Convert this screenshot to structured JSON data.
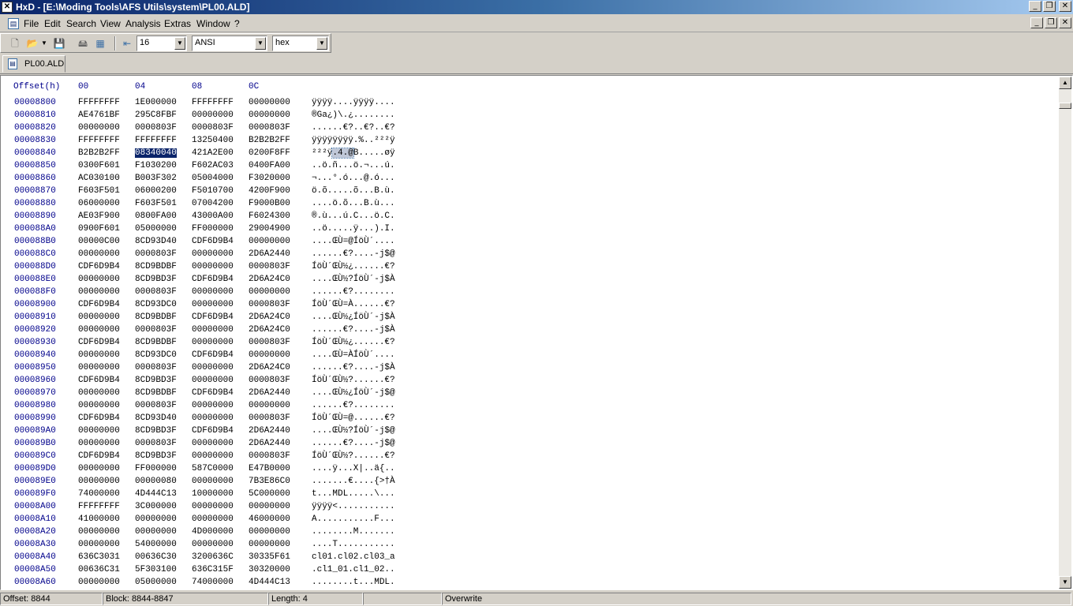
{
  "window": {
    "title": "HxD - [E:\\Moding Tools\\AFS Utils\\system\\PL00.ALD]",
    "app_icon": "hxd-app-icon",
    "buttons": [
      "_",
      "❐",
      "✕"
    ]
  },
  "menu": {
    "items": [
      "File",
      "Edit",
      "Search",
      "View",
      "Analysis",
      "Extras",
      "Window",
      "?"
    ],
    "doc_icon": "document-icon"
  },
  "toolbar": {
    "bytes_per_row": "16",
    "charset": "ANSI",
    "offset_base": "hex",
    "icons": [
      "new-file-icon",
      "open-file-icon",
      "save-icon",
      "open-disk-icon",
      "open-ram-icon",
      "bytes-per-row-icon"
    ]
  },
  "tabs": [
    {
      "label": "PL00.ALD"
    }
  ],
  "hex_view": {
    "header": {
      "offset": "Offset(h)",
      "cols": [
        "00",
        "04",
        "08",
        "0C"
      ]
    },
    "rows": [
      {
        "offset": "00008800",
        "groups": [
          "FFFFFFFF",
          "1E000000",
          "FFFFFFFF",
          "00000000"
        ],
        "text": "ÿÿÿÿ....ÿÿÿÿ...."
      },
      {
        "offset": "00008810",
        "groups": [
          "AE4761BF",
          "295C8FBF",
          "00000000",
          "00000000"
        ],
        "text": "®Ga¿)\\.¿........"
      },
      {
        "offset": "00008820",
        "groups": [
          "00000000",
          "0000803F",
          "0000803F",
          "0000803F"
        ],
        "text": "......€?..€?..€?"
      },
      {
        "offset": "00008830",
        "groups": [
          "FFFFFFFF",
          "FFFFFFFF",
          "13250400",
          "B2B2B2FF"
        ],
        "text": "ÿÿÿÿÿÿÿÿ.%..²²²ÿ"
      },
      {
        "offset": "00008840",
        "groups": [
          "B2B2B2FF",
          "08340040",
          "421A2E00",
          "0200F8FF"
        ],
        "text": "²²²ÿ.4.@B.....øÿ"
      },
      {
        "offset": "00008850",
        "groups": [
          "0300F601",
          "F1030200",
          "F602AC03",
          "0400FA00"
        ],
        "text": "..ö.ñ...ö.¬...ú."
      },
      {
        "offset": "00008860",
        "groups": [
          "AC030100",
          "B003F302",
          "05004000",
          "F3020000"
        ],
        "text": "¬...°.ó...@.ó..."
      },
      {
        "offset": "00008870",
        "groups": [
          "F603F501",
          "06000200",
          "F5010700",
          "4200F900"
        ],
        "text": "ö.õ.....õ...B.ù."
      },
      {
        "offset": "00008880",
        "groups": [
          "06000000",
          "F603F501",
          "07004200",
          "F9000B00"
        ],
        "text": "....ö.õ...B.ù..."
      },
      {
        "offset": "00008890",
        "groups": [
          "AE03F900",
          "0800FA00",
          "43000A00",
          "F6024300"
        ],
        "text": "®.ù...ú.C...ö.C."
      },
      {
        "offset": "000088A0",
        "groups": [
          "0900F601",
          "05000000",
          "FF000000",
          "29004900"
        ],
        "text": "..ö.....ÿ...).I."
      },
      {
        "offset": "000088B0",
        "groups": [
          "00000C00",
          "8CD93D40",
          "CDF6D9B4",
          "00000000"
        ],
        "text": "....ŒÙ=@ÍöÙ´...."
      },
      {
        "offset": "000088C0",
        "groups": [
          "00000000",
          "0000803F",
          "00000000",
          "2D6A2440"
        ],
        "text": "......€?....-j$@"
      },
      {
        "offset": "000088D0",
        "groups": [
          "CDF6D9B4",
          "8CD9BDBF",
          "00000000",
          "0000803F"
        ],
        "text": "ÍöÙ´ŒÙ½¿......€?"
      },
      {
        "offset": "000088E0",
        "groups": [
          "00000000",
          "8CD9BD3F",
          "CDF6D9B4",
          "2D6A24C0"
        ],
        "text": "....ŒÙ½?ÍöÙ´-j$À"
      },
      {
        "offset": "000088F0",
        "groups": [
          "00000000",
          "0000803F",
          "00000000",
          "00000000"
        ],
        "text": "......€?........"
      },
      {
        "offset": "00008900",
        "groups": [
          "CDF6D9B4",
          "8CD93DC0",
          "00000000",
          "0000803F"
        ],
        "text": "ÍöÙ´ŒÙ=À......€?"
      },
      {
        "offset": "00008910",
        "groups": [
          "00000000",
          "8CD9BDBF",
          "CDF6D9B4",
          "2D6A24C0"
        ],
        "text": "....ŒÙ½¿ÍöÙ´-j$À"
      },
      {
        "offset": "00008920",
        "groups": [
          "00000000",
          "0000803F",
          "00000000",
          "2D6A24C0"
        ],
        "text": "......€?....-j$À"
      },
      {
        "offset": "00008930",
        "groups": [
          "CDF6D9B4",
          "8CD9BDBF",
          "00000000",
          "0000803F"
        ],
        "text": "ÍöÙ´ŒÙ½¿......€?"
      },
      {
        "offset": "00008940",
        "groups": [
          "00000000",
          "8CD93DC0",
          "CDF6D9B4",
          "00000000"
        ],
        "text": "....ŒÙ=ÀÍöÙ´...."
      },
      {
        "offset": "00008950",
        "groups": [
          "00000000",
          "0000803F",
          "00000000",
          "2D6A24C0"
        ],
        "text": "......€?....-j$À"
      },
      {
        "offset": "00008960",
        "groups": [
          "CDF6D9B4",
          "8CD9BD3F",
          "00000000",
          "0000803F"
        ],
        "text": "ÍöÙ´ŒÙ½?......€?"
      },
      {
        "offset": "00008970",
        "groups": [
          "00000000",
          "8CD9BDBF",
          "CDF6D9B4",
          "2D6A2440"
        ],
        "text": "....ŒÙ½¿ÍöÙ´-j$@"
      },
      {
        "offset": "00008980",
        "groups": [
          "00000000",
          "0000803F",
          "00000000",
          "00000000"
        ],
        "text": "......€?........"
      },
      {
        "offset": "00008990",
        "groups": [
          "CDF6D9B4",
          "8CD93D40",
          "00000000",
          "0000803F"
        ],
        "text": "ÍöÙ´ŒÙ=@......€?"
      },
      {
        "offset": "000089A0",
        "groups": [
          "00000000",
          "8CD9BD3F",
          "CDF6D9B4",
          "2D6A2440"
        ],
        "text": "....ŒÙ½?ÍöÙ´-j$@"
      },
      {
        "offset": "000089B0",
        "groups": [
          "00000000",
          "0000803F",
          "00000000",
          "2D6A2440"
        ],
        "text": "......€?....-j$@"
      },
      {
        "offset": "000089C0",
        "groups": [
          "CDF6D9B4",
          "8CD9BD3F",
          "00000000",
          "0000803F"
        ],
        "text": "ÍöÙ´ŒÙ½?......€?"
      },
      {
        "offset": "000089D0",
        "groups": [
          "00000000",
          "FF000000",
          "587C0000",
          "E47B0000"
        ],
        "text": "....ÿ...X|..ä{.."
      },
      {
        "offset": "000089E0",
        "groups": [
          "00000000",
          "00000080",
          "00000000",
          "7B3E86C0"
        ],
        "text": ".......€....{>†À"
      },
      {
        "offset": "000089F0",
        "groups": [
          "74000000",
          "4D444C13",
          "10000000",
          "5C000000"
        ],
        "text": "t...MDL.....\\..."
      },
      {
        "offset": "00008A00",
        "groups": [
          "FFFFFFFF",
          "3C000000",
          "00000000",
          "00000000"
        ],
        "text": "ÿÿÿÿ<..........."
      },
      {
        "offset": "00008A10",
        "groups": [
          "41000000",
          "00000000",
          "00000000",
          "46000000"
        ],
        "text": "A...........F..."
      },
      {
        "offset": "00008A20",
        "groups": [
          "00000000",
          "00000000",
          "4D000000",
          "00000000"
        ],
        "text": "........M......."
      },
      {
        "offset": "00008A30",
        "groups": [
          "00000000",
          "54000000",
          "00000000",
          "00000000"
        ],
        "text": "....T..........."
      },
      {
        "offset": "00008A40",
        "groups": [
          "636C3031",
          "00636C30",
          "3200636C",
          "30335F61"
        ],
        "text": "cl01.cl02.cl03_a"
      },
      {
        "offset": "00008A50",
        "groups": [
          "00636C31",
          "5F303100",
          "636C315F",
          "30320000"
        ],
        "text": ".cl1_01.cl1_02.."
      },
      {
        "offset": "00008A60",
        "groups": [
          "00000000",
          "05000000",
          "74000000",
          "4D444C13"
        ],
        "text": "........t...MDL."
      }
    ],
    "selection": {
      "row": 4,
      "group": 1,
      "text_selected": ".4.@"
    }
  },
  "status": {
    "offset": "Offset: 8844",
    "block": "Block: 8844-8847",
    "length": "Length: 4",
    "empty": "",
    "mode": "Overwrite"
  },
  "colors": {
    "offset_text": "#00008b",
    "selection_bg": "#0a246a",
    "title_gradient_start": "#0a246a"
  }
}
